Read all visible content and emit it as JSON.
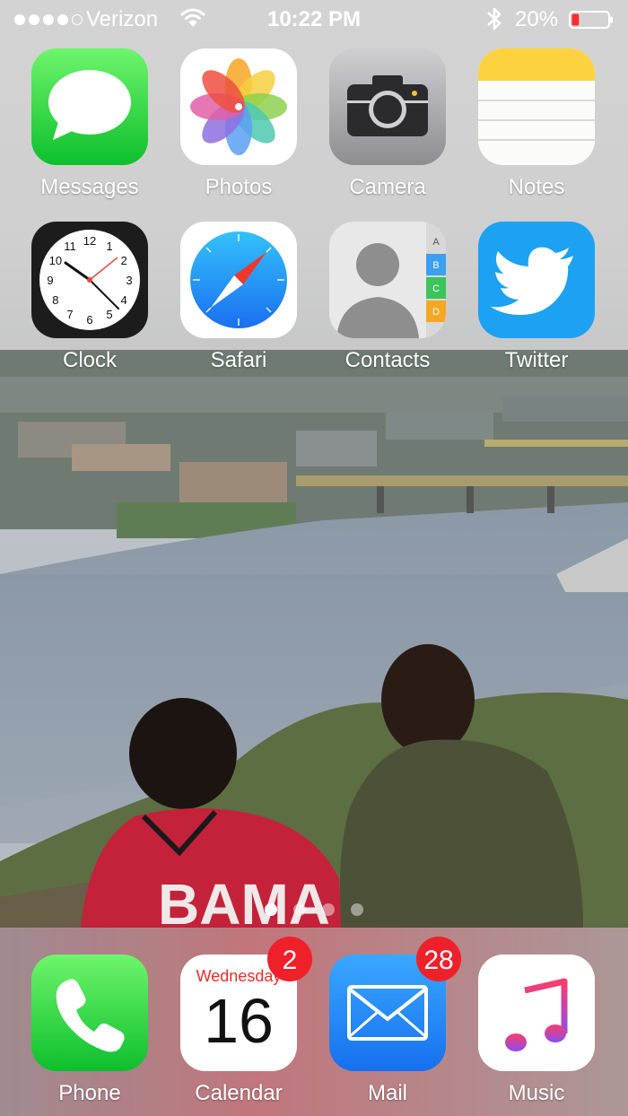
{
  "status_bar": {
    "carrier": "Verizon",
    "time": "10:22 PM",
    "battery_percent": "20%",
    "battery_level": 0.2,
    "signal_bars_filled": 4,
    "signal_bars_total": 5
  },
  "apps": [
    {
      "label": "Messages",
      "icon": "messages-icon"
    },
    {
      "label": "Photos",
      "icon": "photos-icon"
    },
    {
      "label": "Camera",
      "icon": "camera-icon"
    },
    {
      "label": "Notes",
      "icon": "notes-icon"
    },
    {
      "label": "Clock",
      "icon": "clock-icon"
    },
    {
      "label": "Safari",
      "icon": "safari-icon"
    },
    {
      "label": "Contacts",
      "icon": "contacts-icon"
    },
    {
      "label": "Twitter",
      "icon": "twitter-icon"
    }
  ],
  "contacts_tabs": [
    "A",
    "B",
    "C",
    "D"
  ],
  "clock_numbers": [
    "12",
    "1",
    "2",
    "3",
    "4",
    "5",
    "6",
    "7",
    "8",
    "9",
    "10",
    "11"
  ],
  "page_dots": {
    "count": 4,
    "active_index": 0
  },
  "dock": [
    {
      "label": "Phone",
      "icon": "phone-icon"
    },
    {
      "label": "Calendar",
      "icon": "calendar-icon",
      "badge": "2",
      "day_name": "Wednesday",
      "date": "16"
    },
    {
      "label": "Mail",
      "icon": "mail-icon",
      "badge": "28"
    },
    {
      "label": "Music",
      "icon": "music-icon"
    }
  ],
  "wallpaper_text": "BAMA",
  "colors": {
    "badge": "#f0202a",
    "twitter": "#1da1f2",
    "messages_green": "#0dbf2d",
    "battery_low": "#ff2d2d"
  }
}
